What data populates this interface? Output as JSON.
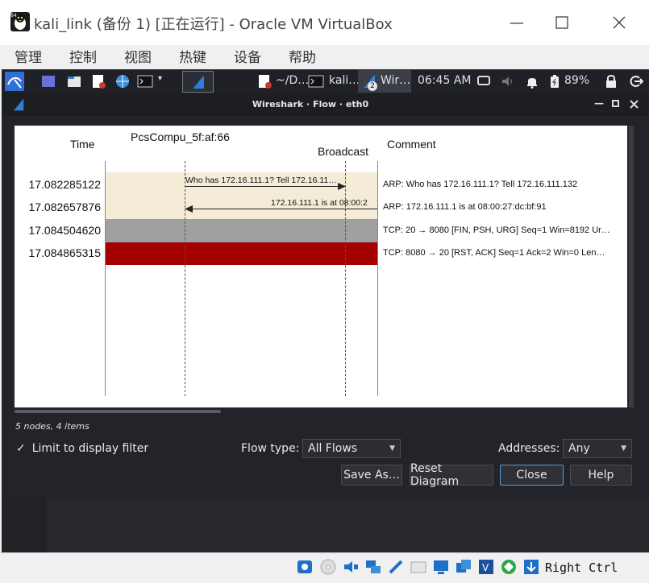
{
  "vbox": {
    "title": "kali_link (备份 1) [正在运行] - Oracle VM VirtualBox",
    "menu": [
      "管理",
      "控制",
      "视图",
      "热键",
      "设备",
      "帮助"
    ],
    "host_key": "Right Ctrl"
  },
  "panel": {
    "task1": "~/D…",
    "task2": "kali…",
    "task3": "Wir…",
    "task3_badge": "2",
    "time": "06:45 AM",
    "battery": "89%"
  },
  "dialog": {
    "title": "Wireshark · Flow · eth0",
    "columns": {
      "time": "Time",
      "node1": "PcsCompu_5f:af:66",
      "node2": "Broadcast",
      "comment": "Comment"
    },
    "rows": [
      {
        "time": "17.082285122",
        "arrow_label": "Who has 172.16.111.1? Tell 172.16.11…",
        "comment": "ARP: Who has 172.16.111.1? Tell 172.16.111.132",
        "color": "#f5ecd8"
      },
      {
        "time": "17.082657876",
        "arrow_label": "172.16.111.1 is at 08:00:2",
        "comment": "ARP: 172.16.111.1 is at 08:00:27:dc:bf:91",
        "color": "#f5ecd8"
      },
      {
        "time": "17.084504620",
        "arrow_label": "",
        "comment": "TCP: 20 → 8080 [FIN, PSH, URG] Seq=1 Win=8192 Ur…",
        "color": "#a0a0a0"
      },
      {
        "time": "17.084865315",
        "arrow_label": "",
        "comment": "TCP: 8080 → 20 [RST, ACK] Seq=1 Ack=2 Win=0 Len…",
        "color": "#a40000"
      }
    ],
    "status": "5 nodes, 4 items",
    "limit_filter_label": "Limit to display filter",
    "limit_filter_checked": true,
    "flow_type_label": "Flow type:",
    "flow_type_value": "All Flows",
    "addresses_label": "Addresses:",
    "addresses_value": "Any",
    "buttons": {
      "save_as": "Save As…",
      "reset": "Reset Diagram",
      "close": "Close",
      "help": "Help"
    }
  }
}
